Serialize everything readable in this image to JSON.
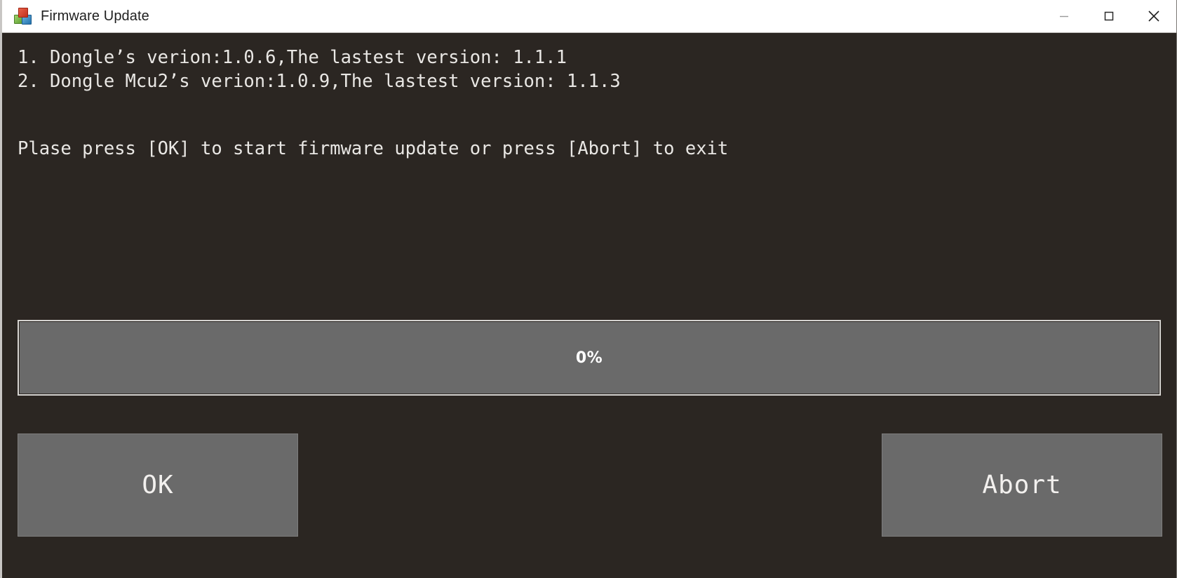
{
  "window": {
    "title": "Firmware Update",
    "icon": "app-cubes-icon",
    "background_color": "#2b2622",
    "titlebar_color": "#ffffff",
    "accent_gray": "#6a6a6a"
  },
  "window_controls": {
    "minimize": "minimize-icon",
    "maximize": "maximize-icon",
    "close": "close-icon"
  },
  "log": {
    "lines": [
      "1. Dongle’s verion:1.0.6,The lastest version: 1.1.1",
      "2. Dongle Mcu2’s verion:1.0.9,The lastest version: 1.1.3"
    ],
    "instruction": "Plase press [OK] to start firmware update or press [Abort] to exit"
  },
  "progress": {
    "label": "0%",
    "value": 0,
    "min": 0,
    "max": 100
  },
  "buttons": {
    "ok": "OK",
    "abort": "Abort"
  }
}
